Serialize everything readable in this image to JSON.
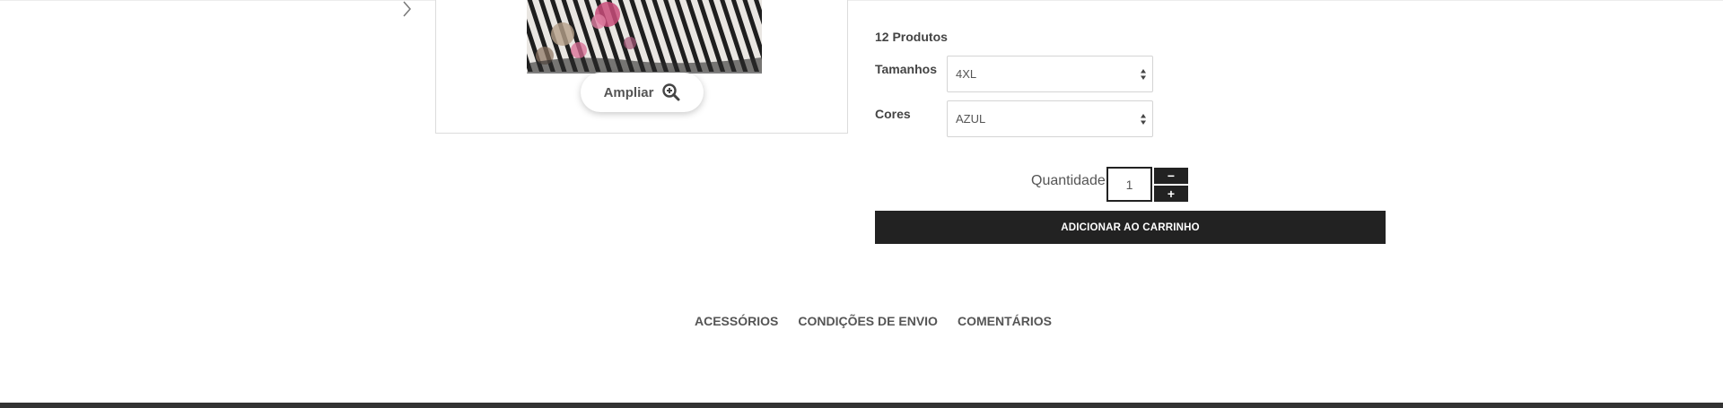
{
  "product": {
    "count_label": "12 Produtos",
    "zoom_label": "Ampliar"
  },
  "options": {
    "size": {
      "label": "Tamanhos",
      "selected": "4XL"
    },
    "color": {
      "label": "Cores",
      "selected": "AZUL"
    }
  },
  "quantity": {
    "label": "Quantidade",
    "value": "1",
    "decrement_label": "−",
    "increment_label": "+"
  },
  "add_to_cart_label": "ADICIONAR AO CARRINHO",
  "tabs": [
    {
      "label": "ACESSÓRIOS"
    },
    {
      "label": "CONDIÇÕES DE ENVIO"
    },
    {
      "label": "COMENTÁRIOS"
    }
  ],
  "icons": {
    "next": "chevron-right-icon",
    "zoom": "zoom-in-icon",
    "select_arrows": "sort-arrows-icon"
  },
  "colors": {
    "dark": "#222222",
    "footer": "#333333",
    "text": "#555555"
  }
}
